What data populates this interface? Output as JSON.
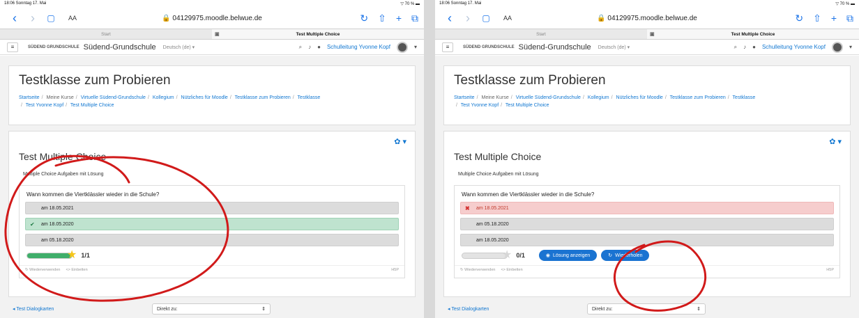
{
  "common": {
    "status_time": "18:06  Sonntag 17. Mai",
    "status_right": "▽ 70 % ▬",
    "url": "🔒 04129975.moodle.belwue.de",
    "aa": "AA",
    "tab_start": "Start",
    "tab_active": "Test Multiple Choice",
    "site_name": "Südend-Grundschule",
    "logo_text": "SÜDEND GRUNDSCHULE",
    "language": "Deutsch (de) ▾",
    "user": "Schulleitung Yvonne Kopf",
    "course_title": "Testklasse zum Probieren",
    "breadcrumb": [
      "Startseite",
      "Meine Kurse",
      "Virtuelle Südend-Grundschule",
      "Kollegium",
      "Nützliches für Moodle",
      "Testklasse zum Probieren",
      "Testklasse",
      "Test Yvonne Kopf",
      "Test Multiple Choice"
    ],
    "activity_title": "Test Multiple Choice",
    "activity_desc": "Multiple Choice Aufgaben mit Lösung",
    "question": "Wann kommen die Viertklässler wieder in die Schule?",
    "reuse": "↻ Wiederverwenden",
    "embed": "<> Einbetten",
    "h5p": "H5P",
    "prev_link": "◂ Test Dialogkarten",
    "jump_label": "Direkt zu:"
  },
  "left": {
    "options": [
      {
        "text": "am 18.05.2021",
        "state": ""
      },
      {
        "text": "am 18.05.2020",
        "state": "correct"
      },
      {
        "text": "am 05.18.2020",
        "state": ""
      }
    ],
    "score": "1/1",
    "progress_fraction": 1.0
  },
  "right": {
    "options": [
      {
        "text": "am 18.05.2021",
        "state": "wrong"
      },
      {
        "text": "am 05.18.2020",
        "state": ""
      },
      {
        "text": "am 18.05.2020",
        "state": ""
      }
    ],
    "score": "0/1",
    "progress_fraction": 0.0,
    "show_solution_label": "Lösung anzeigen",
    "retry_label": "Wiederholen"
  },
  "colors": {
    "link": "#1177d1",
    "correct_bg": "#bfe3cf",
    "wrong_bg": "#f6cdcd",
    "ink": "#d11a1a"
  },
  "icons": [
    "back-icon",
    "forward-icon",
    "book-icon",
    "reload-icon",
    "share-icon",
    "plus-icon",
    "tabs-icon",
    "menu-icon",
    "search-icon",
    "bell-icon",
    "chat-icon",
    "gear-icon",
    "check-icon",
    "cross-icon",
    "star-icon",
    "eye-icon",
    "refresh-icon"
  ]
}
